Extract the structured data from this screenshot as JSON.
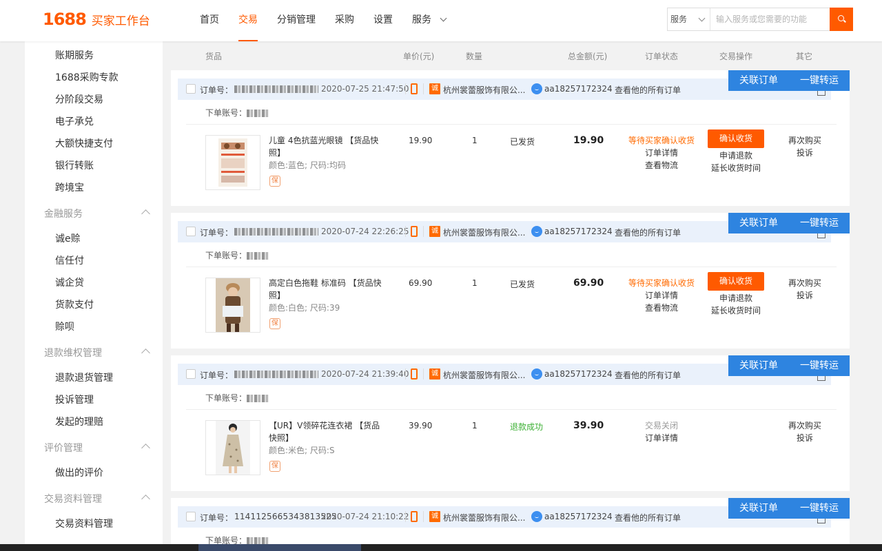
{
  "brand": {
    "number": "1688",
    "title": "买家工作台"
  },
  "nav": {
    "items": [
      {
        "label": "首页"
      },
      {
        "label": "交易",
        "active": true
      },
      {
        "label": "分销管理"
      },
      {
        "label": "采购"
      },
      {
        "label": "设置"
      },
      {
        "label": "服务"
      }
    ]
  },
  "search": {
    "scope": "服务",
    "placeholder": "输入服务或您需要的功能"
  },
  "sidebar": {
    "items": {
      "a1": "账期服务",
      "a2": "1688采购专款",
      "a3": "分阶段交易",
      "a4": "电子承兑",
      "a5": "大额快捷支付",
      "a6": "银行转账",
      "a7": "跨境宝",
      "h1": "金融服务",
      "b1": "诚e赊",
      "b2": "信任付",
      "b3": "诚企贷",
      "b4": "货款支付",
      "b5": "赊呗",
      "h2": "退款维权管理",
      "c1": "退款退货管理",
      "c2": "投诉管理",
      "c3": "发起的理赔",
      "h3": "评价管理",
      "d1": "做出的评价",
      "h4": "交易资料管理",
      "e1": "交易资料管理"
    }
  },
  "table_header": {
    "goods": "货品",
    "unit_price": "单价(元)",
    "quantity": "数量",
    "total": "总金额(元)",
    "status": "订单状态",
    "operation": "交易操作",
    "other": "其它"
  },
  "common": {
    "order_no_label": "订单号：",
    "account_label": "下单账号：",
    "shop": "杭州裳蕾服饰有限公...",
    "buyer": "aa18257172324",
    "all_orders": "查看他的所有订单",
    "link_order": "关联订单",
    "one_click": "一键转运",
    "order_detail": "订单详情",
    "view_logistics": "查看物流",
    "confirm_receipt": "确认收货",
    "apply_refund": "申请退款",
    "extend_time": "延长收货时间",
    "rebuy": "再次购买",
    "complain": "投诉",
    "bao": "保",
    "shop_badge": "诚"
  },
  "orders": [
    {
      "date": "2020-07-25 21:47:50",
      "product": "儿童 4色抗蓝光眼镜 【货品快照】",
      "attrs": "颜色:蓝色;  尺码:均码",
      "price": "19.90",
      "qty": "1",
      "ship": "已发货",
      "total": "19.90",
      "status": "等待买家确认收货"
    },
    {
      "date": "2020-07-24 22:26:25",
      "product": "高定白色拖鞋 标准码 【货品快照】",
      "attrs": "颜色:白色;  尺码:39",
      "price": "69.90",
      "qty": "1",
      "ship": "已发货",
      "total": "69.90",
      "status": "等待买家确认收货"
    },
    {
      "date": "2020-07-24 21:39:40",
      "product": "【UR】V领碎花连衣裙 【货品快照】",
      "attrs": "颜色:米色;  尺码:S",
      "price": "39.90",
      "qty": "1",
      "ship": "退款成功",
      "total": "39.90",
      "status": "交易关闭"
    },
    {
      "order_no": "1141125665343813525",
      "date": "2020-07-24 21:10:22"
    }
  ],
  "colors": {
    "brand": "#ff5a00",
    "blue_button": "#2e84e0",
    "header_row": "#eaf1fb",
    "success": "#3cb034"
  }
}
